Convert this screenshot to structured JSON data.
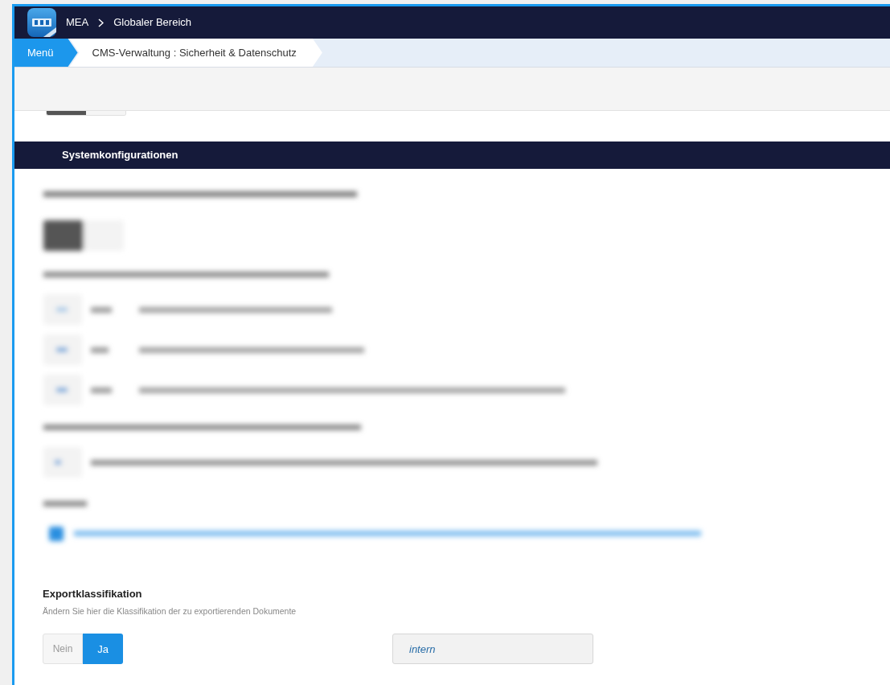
{
  "top_bar": {
    "crumbs": [
      "MEA",
      "Globaler Bereich"
    ]
  },
  "nav": {
    "items": [
      {
        "label": "Menü",
        "selected": true
      },
      {
        "label": "CMS-Verwaltung : Sicherheit & Datenschutz",
        "selected": false
      }
    ]
  },
  "section": {
    "title": "Systemkonfigurationen"
  },
  "export": {
    "title": "Exportklassifikation",
    "description": "Ändern Sie hier die Klassifikation der zu exportierenden Dokumente",
    "options": [
      {
        "label": "Nein",
        "selected": false
      },
      {
        "label": "Ja",
        "selected": true
      }
    ],
    "field": {
      "value": "intern"
    }
  }
}
